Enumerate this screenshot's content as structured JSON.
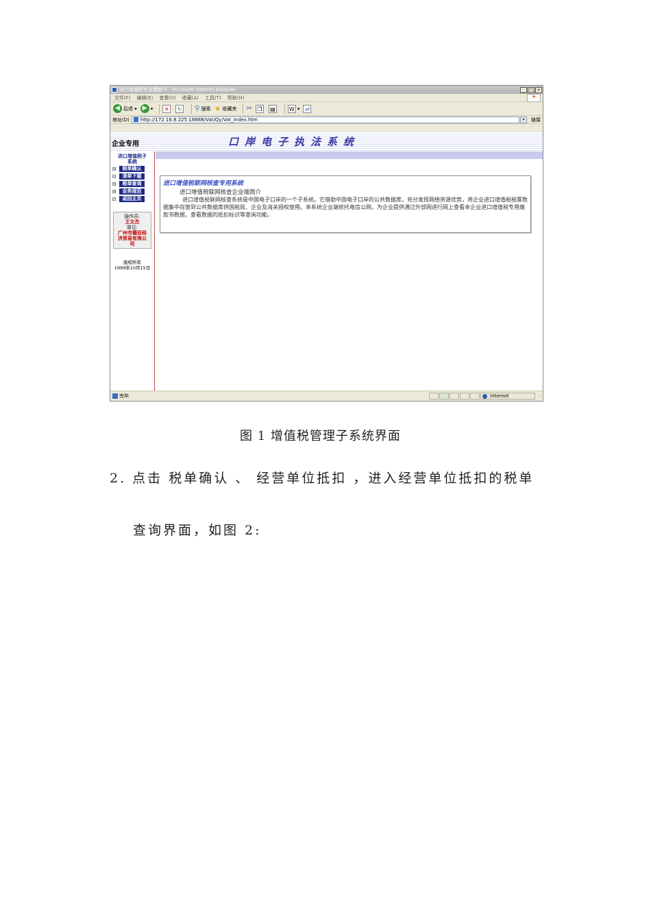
{
  "window": {
    "title": "进口增值税专业缴款书 - Microsoft Internet Explorer",
    "controls": [
      "_",
      "□",
      "×"
    ]
  },
  "menu": [
    "文件(F)",
    "编辑(E)",
    "查看(V)",
    "收藏(A)",
    "工具(T)",
    "帮助(H)"
  ],
  "toolbar": {
    "back": "后退",
    "search": "搜索",
    "favorites": "收藏夹"
  },
  "address": {
    "label": "地址(D)",
    "url": "http://172.16.8.225:18888/Vat/Qy/Vat_Index.htm",
    "links": "链接"
  },
  "site": {
    "corp_label": "企业专用",
    "title": "口岸电子执法系统"
  },
  "nav": {
    "header_line1": "进口增值税子",
    "header_line2": "系统",
    "items": [
      "税单确认",
      "清单下载",
      "税单查询",
      "业务规范",
      "返回主页"
    ],
    "expanders": [
      "+",
      "−",
      "+",
      "+",
      "−"
    ],
    "operator_label": "操作员:",
    "operator_name": "王文杰",
    "unit_label": "单位:",
    "unit_name_line1": "广州市穗亚经",
    "unit_name_line2": "济贸易有限公",
    "unit_name_line3": "司",
    "copyright_line1": "版权所有",
    "copyright_line2": "1999年10月15日"
  },
  "panel": {
    "title": "进口增值税联网核查专用系统",
    "subtitle": "进口增值税联网核查企业端简介",
    "body": "进口增值税联网核查系统是中国电子口岸的一个子系统。它借助中国电子口岸的公共数据库，充分发挥网络资源优势，将企业进口增值税税票数据集中存放到公共数据库供国税局、企业及海关授权使用。本系统企业端依托电信公网，为企业提供通过外部网进行网上查看本企业进口增值税专用缴款书数据，查看数据的抵扣标识等查询功能。"
  },
  "status": {
    "text": "完毕",
    "zone": "Internet"
  },
  "document": {
    "caption": "图 1 增值税管理子系统界面",
    "step": "2. 点击 税单确认 、 经营单位抵扣 ，进入经营单位抵扣的税单",
    "step_cont": "查询界面，如图 2:"
  }
}
